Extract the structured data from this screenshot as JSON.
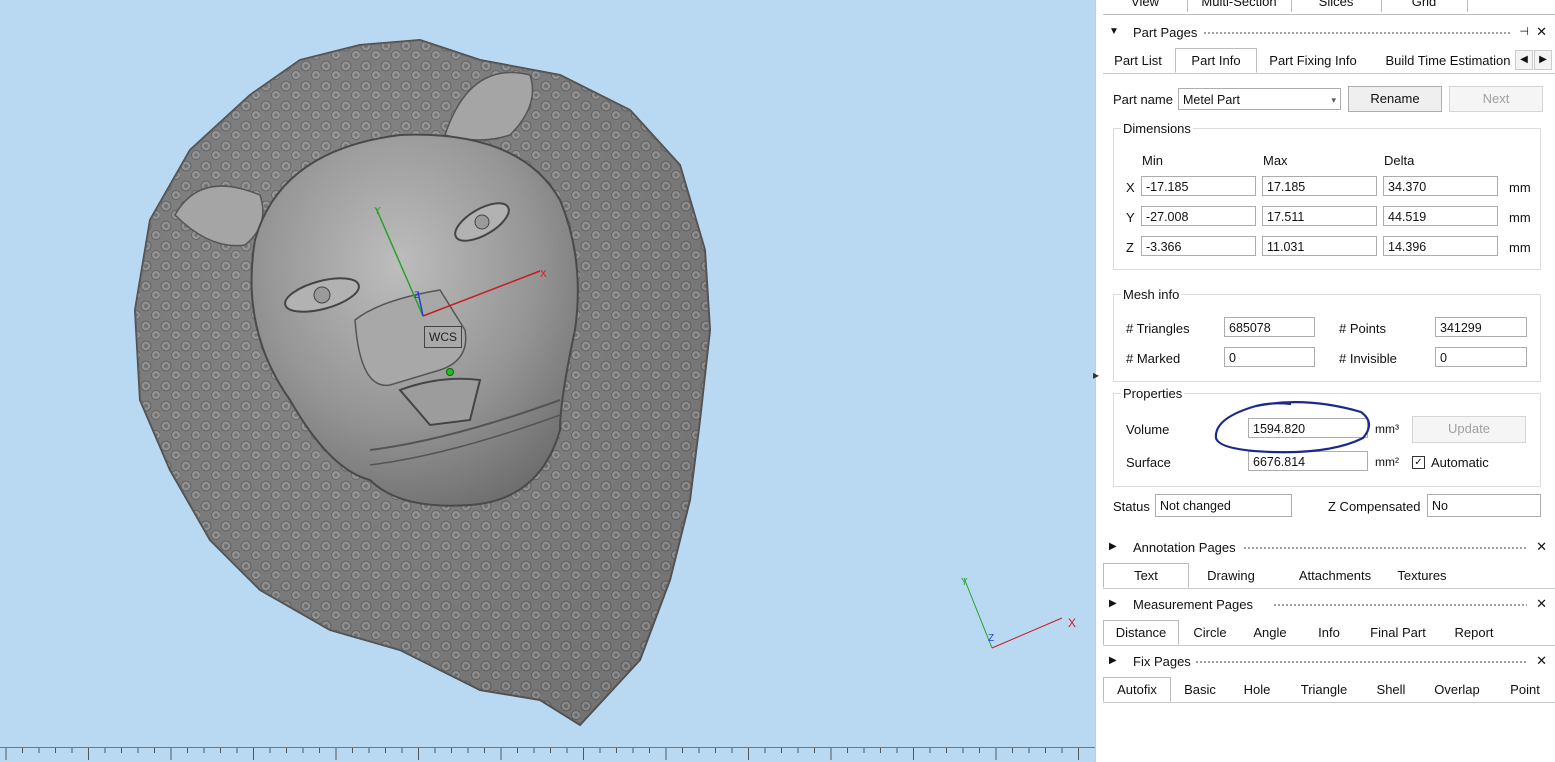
{
  "viewport": {
    "wcs_label": "WCS",
    "axes": {
      "x": "X",
      "y": "Y",
      "z": "Z"
    }
  },
  "top_tabs": [
    "View",
    "Multi-Section",
    "Slices",
    "Grid"
  ],
  "part_pages": {
    "title": "Part Pages",
    "tabs": [
      "Part List",
      "Part Info",
      "Part Fixing Info",
      "Build Time Estimation"
    ],
    "active_tab": "Part Info",
    "part_name_label": "Part name",
    "part_name_value": "Metel Part",
    "rename_label": "Rename",
    "next_label": "Next",
    "dimensions": {
      "title": "Dimensions",
      "headers": [
        "Min",
        "Max",
        "Delta"
      ],
      "unit": "mm",
      "rows": [
        {
          "axis": "X",
          "min": "-17.185",
          "max": "17.185",
          "delta": "34.370"
        },
        {
          "axis": "Y",
          "min": "-27.008",
          "max": "17.511",
          "delta": "44.519"
        },
        {
          "axis": "Z",
          "min": "-3.366",
          "max": "11.031",
          "delta": "14.396"
        }
      ]
    },
    "mesh_info": {
      "title": "Mesh info",
      "triangles_label": "# Triangles",
      "triangles": "685078",
      "points_label": "# Points",
      "points": "341299",
      "marked_label": "# Marked",
      "marked": "0",
      "invisible_label": "# Invisible",
      "invisible": "0"
    },
    "properties": {
      "title": "Properties",
      "volume_label": "Volume",
      "volume": "1594.820",
      "volume_unit": "mm³",
      "update_label": "Update",
      "surface_label": "Surface",
      "surface": "6676.814",
      "surface_unit": "mm²",
      "automatic_label": "Automatic",
      "automatic_checked": true
    },
    "status_label": "Status",
    "status": "Not changed",
    "z_comp_label": "Z Compensated",
    "z_comp": "No"
  },
  "annotation_pages": {
    "title": "Annotation Pages",
    "tabs": [
      "Text",
      "Drawing",
      "Attachments",
      "Textures"
    ]
  },
  "measurement_pages": {
    "title": "Measurement Pages",
    "tabs": [
      "Distance",
      "Circle",
      "Angle",
      "Info",
      "Final Part",
      "Report"
    ]
  },
  "fix_pages": {
    "title": "Fix Pages",
    "tabs": [
      "Autofix",
      "Basic",
      "Hole",
      "Triangle",
      "Shell",
      "Overlap",
      "Point"
    ]
  },
  "colors": {
    "viewport_bg": "#b9d9f3",
    "model": "#8a8a8a",
    "annotation_ink": "#1b2a8a"
  }
}
